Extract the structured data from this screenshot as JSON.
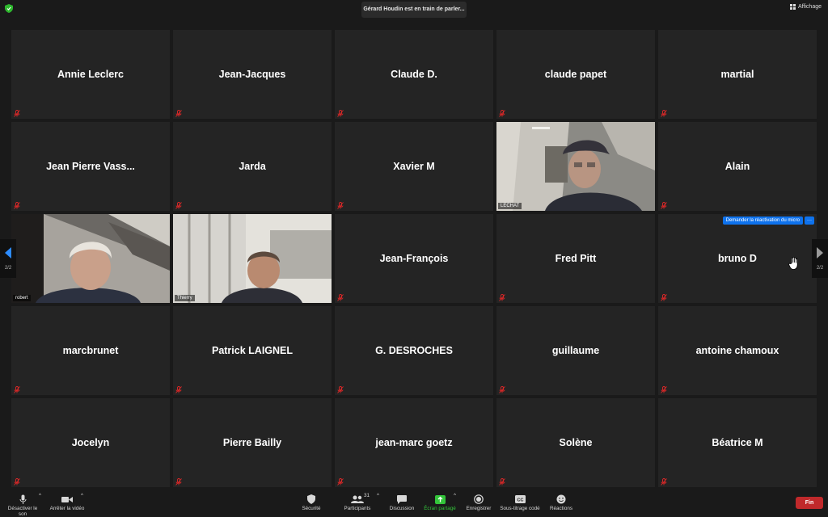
{
  "top": {
    "speaking": "Gérard Houdin est en train de parler...",
    "view_label": "Affichage"
  },
  "tiles": [
    "Annie Leclerc",
    "Jean-Jacques",
    "Claude D.",
    "claude papet",
    "martial",
    "Jean  Pierre  Vass...",
    "Jarda",
    "Xavier M",
    "",
    "Alain",
    "",
    "",
    "Jean-François",
    "Fred Pitt",
    "bruno D",
    "marcbrunet",
    "Patrick LAIGNEL",
    "G. DESROCHES",
    "guillaume",
    "antoine chamoux",
    "Jocelyn",
    "Pierre Bailly",
    "jean-marc goetz",
    "Solène",
    "Béatrice M"
  ],
  "video_tiles": {
    "lechat": "LECHAT",
    "robert": "robert",
    "thierry": "Thierry"
  },
  "request_unmute": {
    "label": "Demander la réactivation du micro",
    "more": "···"
  },
  "pager": {
    "left": "2/2",
    "right": "2/2"
  },
  "toolbar": {
    "mute": "Désactiver le son",
    "video": "Arrêter la vidéo",
    "security": "Sécurité",
    "participants": "Participants",
    "participants_count": "31",
    "chat": "Discussion",
    "share": "Écran partagé",
    "record": "Enregistrer",
    "subtitles": "Sous-titrage codé",
    "reactions": "Réactions",
    "end": "Fin"
  },
  "colors": {
    "accent": "#0e72ed",
    "share_green": "#33c43a",
    "end_red": "#c0292b",
    "mute_red": "#e02828"
  }
}
